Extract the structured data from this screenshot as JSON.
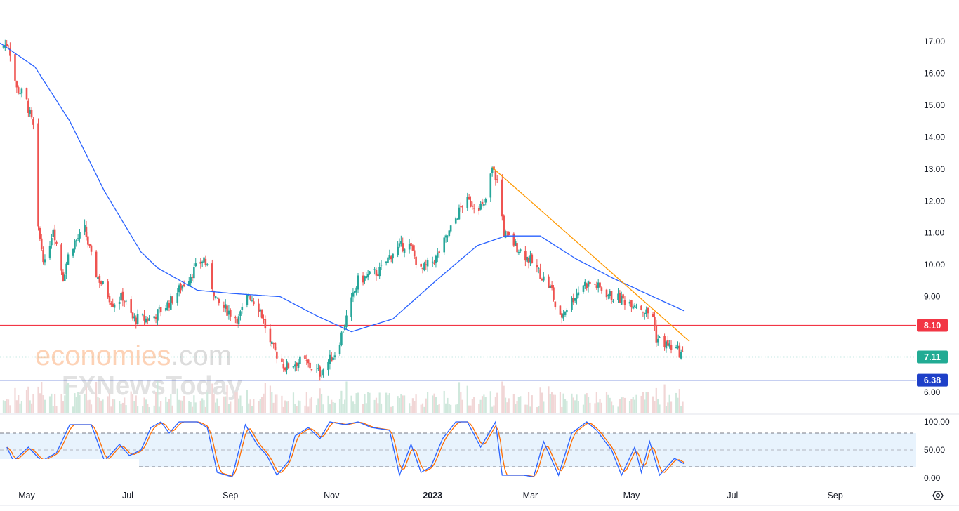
{
  "chart_data": {
    "type": "candlestick",
    "title": "",
    "x_unit": "days since 2022-05-01",
    "price_axis": {
      "ticks": [
        "17.00",
        "16.00",
        "15.00",
        "14.00",
        "13.00",
        "12.00",
        "11.00",
        "10.00",
        "9.00",
        "8.00",
        "7.00",
        "6.00"
      ],
      "ylim": [
        5.9,
        17.4
      ]
    },
    "time_axis": {
      "ticks": [
        {
          "label": "May",
          "day": 0
        },
        {
          "label": "Jul",
          "day": 61
        },
        {
          "label": "Sep",
          "day": 123
        },
        {
          "label": "Nov",
          "day": 184
        },
        {
          "label": "2023",
          "day": 245
        },
        {
          "label": "Mar",
          "day": 304
        },
        {
          "label": "May",
          "day": 365
        },
        {
          "label": "Jul",
          "day": 426
        },
        {
          "label": "Sep",
          "day": 488
        }
      ]
    },
    "price_path": [
      [
        -16,
        16.8
      ],
      [
        -11,
        16.95
      ],
      [
        -6,
        15.5
      ],
      [
        -1,
        15.3
      ],
      [
        4,
        14.3
      ],
      [
        6,
        11.3
      ],
      [
        11,
        10.0
      ],
      [
        16,
        11.2
      ],
      [
        22,
        9.6
      ],
      [
        26,
        10.5
      ],
      [
        35,
        11.1
      ],
      [
        41,
        9.8
      ],
      [
        52,
        8.8
      ],
      [
        58,
        9.0
      ],
      [
        64,
        8.3
      ],
      [
        75,
        8.3
      ],
      [
        86,
        8.8
      ],
      [
        96,
        9.5
      ],
      [
        107,
        10.2
      ],
      [
        115,
        8.8
      ],
      [
        128,
        8.3
      ],
      [
        134,
        9.1
      ],
      [
        141,
        8.6
      ],
      [
        147,
        7.5
      ],
      [
        156,
        6.8
      ],
      [
        166,
        7.0
      ],
      [
        177,
        6.6
      ],
      [
        187,
        7.3
      ],
      [
        194,
        8.5
      ],
      [
        200,
        9.5
      ],
      [
        213,
        9.8
      ],
      [
        221,
        10.4
      ],
      [
        230,
        10.7
      ],
      [
        238,
        9.8
      ],
      [
        247,
        10.2
      ],
      [
        255,
        11.0
      ],
      [
        264,
        12.0
      ],
      [
        276,
        11.8
      ],
      [
        281,
        13.0
      ],
      [
        285,
        12.5
      ],
      [
        288,
        11.0
      ],
      [
        297,
        10.5
      ],
      [
        306,
        10.0
      ],
      [
        317,
        9.2
      ],
      [
        321,
        8.2
      ],
      [
        325,
        8.6
      ],
      [
        336,
        9.4
      ],
      [
        342,
        9.4
      ],
      [
        353,
        9.0
      ],
      [
        367,
        8.8
      ],
      [
        374,
        8.5
      ],
      [
        378,
        8.4
      ],
      [
        380,
        7.7
      ],
      [
        386,
        7.5
      ],
      [
        393,
        7.3
      ],
      [
        397,
        7.11
      ]
    ],
    "moving_average": [
      [
        -16,
        16.95
      ],
      [
        5,
        16.2
      ],
      [
        26,
        14.5
      ],
      [
        47,
        12.3
      ],
      [
        69,
        10.4
      ],
      [
        79,
        9.9
      ],
      [
        103,
        9.2
      ],
      [
        124,
        9.1
      ],
      [
        153,
        9.0
      ],
      [
        175,
        8.4
      ],
      [
        196,
        7.9
      ],
      [
        221,
        8.3
      ],
      [
        247,
        9.5
      ],
      [
        272,
        10.6
      ],
      [
        289,
        10.9
      ],
      [
        310,
        10.9
      ],
      [
        331,
        10.2
      ],
      [
        353,
        9.6
      ],
      [
        378,
        9.0
      ],
      [
        397,
        8.55
      ]
    ],
    "trendline": [
      [
        281,
        13.05
      ],
      [
        400,
        7.6
      ]
    ],
    "levels": [
      {
        "label": "8.10",
        "value": 8.1,
        "color": "#f23645",
        "style": "solid"
      },
      {
        "label": "7.11",
        "value": 7.11,
        "color": "#22ab94",
        "style": "dotted"
      },
      {
        "label": "6.38",
        "value": 6.38,
        "color": "#1e40c8",
        "style": "solid"
      }
    ],
    "stochastic": {
      "ticks": [
        "100.00",
        "50.00",
        "0.00"
      ],
      "upper_band": 80,
      "lower_band": 20,
      "k": [
        [
          -12,
          55
        ],
        [
          -8,
          30
        ],
        [
          1,
          55
        ],
        [
          9,
          30
        ],
        [
          18,
          45
        ],
        [
          26,
          95
        ],
        [
          39,
          95
        ],
        [
          47,
          30
        ],
        [
          56,
          60
        ],
        [
          62,
          40
        ],
        [
          69,
          50
        ],
        [
          75,
          90
        ],
        [
          81,
          100
        ],
        [
          86,
          80
        ],
        [
          92,
          100
        ],
        [
          103,
          100
        ],
        [
          109,
          90
        ],
        [
          115,
          10
        ],
        [
          124,
          2
        ],
        [
          132,
          95
        ],
        [
          139,
          60
        ],
        [
          145,
          40
        ],
        [
          151,
          5
        ],
        [
          158,
          30
        ],
        [
          162,
          75
        ],
        [
          170,
          90
        ],
        [
          177,
          70
        ],
        [
          183,
          100
        ],
        [
          192,
          95
        ],
        [
          200,
          100
        ],
        [
          208,
          90
        ],
        [
          219,
          85
        ],
        [
          225,
          5
        ],
        [
          232,
          60
        ],
        [
          238,
          10
        ],
        [
          244,
          20
        ],
        [
          251,
          70
        ],
        [
          259,
          100
        ],
        [
          266,
          100
        ],
        [
          274,
          55
        ],
        [
          283,
          100
        ],
        [
          287,
          5
        ],
        [
          300,
          5
        ],
        [
          306,
          2
        ],
        [
          312,
          65
        ],
        [
          321,
          5
        ],
        [
          329,
          80
        ],
        [
          338,
          100
        ],
        [
          344,
          85
        ],
        [
          353,
          50
        ],
        [
          359,
          5
        ],
        [
          367,
          55
        ],
        [
          371,
          10
        ],
        [
          376,
          65
        ],
        [
          382,
          5
        ],
        [
          391,
          35
        ],
        [
          397,
          25
        ]
      ]
    },
    "colors": {
      "up": "#26a69a",
      "down": "#ef5350",
      "ma": "#2962ff",
      "trend": "#ff9800",
      "k": "#2962ff",
      "d": "#ff6d00"
    }
  },
  "watermark": {
    "brand1": "economies",
    "brand1_suffix": ".com",
    "brand2": "FXNewsToday"
  },
  "icons": {
    "settings": "settings-hex-icon"
  }
}
